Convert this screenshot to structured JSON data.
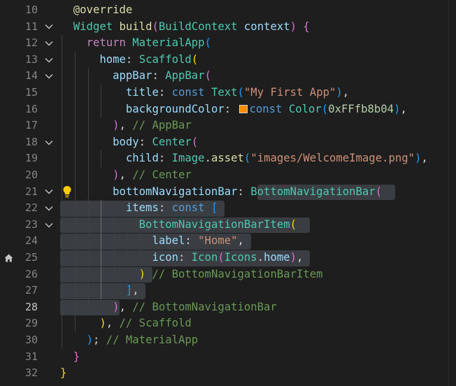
{
  "colors": {
    "background": "#1e1e1e",
    "keyword": "#569cd6",
    "control": "#c586c0",
    "type": "#4ec9b0",
    "function": "#dcdcaa",
    "variable": "#9cdcfe",
    "string": "#ce9178",
    "number": "#b5cea8",
    "comment": "#6a9955",
    "bracket_gold": "#ffd700",
    "bracket_pink": "#da70d6",
    "bracket_blue": "#179fff",
    "swatch": "#fb8b04",
    "highlight": "#3a3d41"
  },
  "editor": {
    "active_line": 28,
    "lines": [
      {
        "n": "10",
        "fold": false,
        "gutter_icon": "",
        "tokens": [
          {
            "t": "  "
          },
          {
            "t": "@override",
            "c": "#dcdcaa"
          }
        ]
      },
      {
        "n": "11",
        "fold": true,
        "gutter_icon": "",
        "tokens": [
          {
            "t": "  "
          },
          {
            "t": "Widget",
            "c": "#4ec9b0"
          },
          {
            "t": " "
          },
          {
            "t": "build",
            "c": "#dcdcaa"
          },
          {
            "t": "(",
            "c": "#da70d6"
          },
          {
            "t": "BuildContext",
            "c": "#4ec9b0"
          },
          {
            "t": " "
          },
          {
            "t": "context",
            "c": "#9cdcfe"
          },
          {
            "t": ")",
            "c": "#da70d6"
          },
          {
            "t": " "
          },
          {
            "t": "{",
            "c": "#da70d6"
          }
        ]
      },
      {
        "n": "12",
        "fold": true,
        "gutter_icon": "",
        "tokens": [
          {
            "t": "    "
          },
          {
            "t": "return",
            "c": "#c586c0"
          },
          {
            "t": " "
          },
          {
            "t": "MaterialApp",
            "c": "#4ec9b0"
          },
          {
            "t": "(",
            "c": "#179fff"
          }
        ]
      },
      {
        "n": "13",
        "fold": true,
        "gutter_icon": "",
        "tokens": [
          {
            "t": "      "
          },
          {
            "t": "home",
            "c": "#9cdcfe"
          },
          {
            "t": ": "
          },
          {
            "t": "Scaffold",
            "c": "#4ec9b0"
          },
          {
            "t": "(",
            "c": "#ffd700"
          }
        ]
      },
      {
        "n": "14",
        "fold": true,
        "gutter_icon": "",
        "tokens": [
          {
            "t": "        "
          },
          {
            "t": "appBar",
            "c": "#9cdcfe"
          },
          {
            "t": ": "
          },
          {
            "t": "AppBar",
            "c": "#4ec9b0"
          },
          {
            "t": "(",
            "c": "#da70d6"
          }
        ]
      },
      {
        "n": "15",
        "fold": false,
        "gutter_icon": "",
        "tokens": [
          {
            "t": "          "
          },
          {
            "t": "title",
            "c": "#9cdcfe"
          },
          {
            "t": ": "
          },
          {
            "t": "const",
            "c": "#569cd6"
          },
          {
            "t": " "
          },
          {
            "t": "Text",
            "c": "#4ec9b0"
          },
          {
            "t": "(",
            "c": "#179fff"
          },
          {
            "t": "\"My First App\"",
            "c": "#ce9178"
          },
          {
            "t": ")",
            "c": "#179fff"
          },
          {
            "t": ","
          }
        ]
      },
      {
        "n": "16",
        "fold": false,
        "gutter_icon": "",
        "tokens": [
          {
            "t": "          "
          },
          {
            "t": "backgroundColor",
            "c": "#9cdcfe"
          },
          {
            "t": ": "
          },
          {
            "swatch": true
          },
          {
            "t": "const",
            "c": "#569cd6"
          },
          {
            "t": " "
          },
          {
            "t": "Color",
            "c": "#4ec9b0"
          },
          {
            "t": "(",
            "c": "#179fff"
          },
          {
            "t": "0xFFfb8b04",
            "c": "#b5cea8"
          },
          {
            "t": ")",
            "c": "#179fff"
          },
          {
            "t": ","
          }
        ]
      },
      {
        "n": "17",
        "fold": false,
        "gutter_icon": "",
        "tokens": [
          {
            "t": "        "
          },
          {
            "t": ")",
            "c": "#da70d6"
          },
          {
            "t": ", "
          },
          {
            "t": "// AppBar",
            "c": "#6a9955"
          }
        ]
      },
      {
        "n": "18",
        "fold": true,
        "gutter_icon": "",
        "tokens": [
          {
            "t": "        "
          },
          {
            "t": "body",
            "c": "#9cdcfe"
          },
          {
            "t": ": "
          },
          {
            "t": "Center",
            "c": "#4ec9b0"
          },
          {
            "t": "(",
            "c": "#da70d6"
          }
        ]
      },
      {
        "n": "19",
        "fold": false,
        "gutter_icon": "",
        "tokens": [
          {
            "t": "          "
          },
          {
            "t": "child",
            "c": "#9cdcfe"
          },
          {
            "t": ": "
          },
          {
            "t": "Image",
            "c": "#4ec9b0"
          },
          {
            "t": "."
          },
          {
            "t": "asset",
            "c": "#dcdcaa"
          },
          {
            "t": "(",
            "c": "#179fff"
          },
          {
            "t": "\"images/WelcomeImage.png\"",
            "c": "#ce9178"
          },
          {
            "t": ")",
            "c": "#179fff"
          },
          {
            "t": ","
          }
        ]
      },
      {
        "n": "20",
        "fold": false,
        "gutter_icon": "",
        "tokens": [
          {
            "t": "        "
          },
          {
            "t": ")",
            "c": "#da70d6"
          },
          {
            "t": ", "
          },
          {
            "t": "// Center",
            "c": "#6a9955"
          }
        ]
      },
      {
        "n": "21",
        "fold": true,
        "gutter_icon": "",
        "bulb": true,
        "tokens": [
          {
            "t": "        "
          },
          {
            "t": "bottomNavigationBar",
            "c": "#9cdcfe"
          },
          {
            "t": ": "
          },
          {
            "t": "BottomNavigationBar",
            "c": "#4ec9b0"
          },
          {
            "t": "(",
            "c": "#da70d6"
          }
        ]
      },
      {
        "n": "22",
        "fold": true,
        "gutter_icon": "",
        "tokens": [
          {
            "t": "          "
          },
          {
            "t": "items",
            "c": "#9cdcfe"
          },
          {
            "t": ": "
          },
          {
            "t": "const",
            "c": "#569cd6"
          },
          {
            "t": " "
          },
          {
            "t": "[",
            "c": "#179fff"
          }
        ]
      },
      {
        "n": "23",
        "fold": true,
        "gutter_icon": "",
        "tokens": [
          {
            "t": "            "
          },
          {
            "t": "BottomNavigationBarItem",
            "c": "#4ec9b0"
          },
          {
            "t": "(",
            "c": "#ffd700"
          }
        ]
      },
      {
        "n": "24",
        "fold": false,
        "gutter_icon": "",
        "tokens": [
          {
            "t": "              "
          },
          {
            "t": "label",
            "c": "#9cdcfe"
          },
          {
            "t": ": "
          },
          {
            "t": "\"Home\"",
            "c": "#ce9178"
          },
          {
            "t": ","
          }
        ]
      },
      {
        "n": "25",
        "fold": false,
        "gutter_icon": "home-icon",
        "tokens": [
          {
            "t": "              "
          },
          {
            "t": "icon",
            "c": "#9cdcfe"
          },
          {
            "t": ": "
          },
          {
            "t": "Icon",
            "c": "#4ec9b0"
          },
          {
            "t": "(",
            "c": "#da70d6"
          },
          {
            "t": "Icons",
            "c": "#4ec9b0"
          },
          {
            "t": "."
          },
          {
            "t": "home",
            "c": "#9cdcfe"
          },
          {
            "t": ")",
            "c": "#da70d6"
          },
          {
            "t": ","
          }
        ]
      },
      {
        "n": "26",
        "fold": false,
        "gutter_icon": "",
        "tokens": [
          {
            "t": "            "
          },
          {
            "t": ")",
            "c": "#ffd700"
          },
          {
            "t": " "
          },
          {
            "t": "// BottomNavigationBarItem",
            "c": "#6a9955"
          }
        ]
      },
      {
        "n": "27",
        "fold": false,
        "gutter_icon": "",
        "tokens": [
          {
            "t": "          "
          },
          {
            "t": "]",
            "c": "#179fff"
          },
          {
            "t": ","
          }
        ]
      },
      {
        "n": "28",
        "fold": false,
        "gutter_icon": "",
        "tokens": [
          {
            "t": "        "
          },
          {
            "t": ")",
            "c": "#da70d6"
          },
          {
            "t": ", "
          },
          {
            "t": "// BottomNavigationBar",
            "c": "#6a9955"
          }
        ]
      },
      {
        "n": "29",
        "fold": false,
        "gutter_icon": "",
        "tokens": [
          {
            "t": "      "
          },
          {
            "t": ")",
            "c": "#ffd700"
          },
          {
            "t": ", "
          },
          {
            "t": "// Scaffold",
            "c": "#6a9955"
          }
        ]
      },
      {
        "n": "30",
        "fold": false,
        "gutter_icon": "",
        "tokens": [
          {
            "t": "    "
          },
          {
            "t": ")",
            "c": "#179fff"
          },
          {
            "t": "; "
          },
          {
            "t": "// MaterialApp",
            "c": "#6a9955"
          }
        ]
      },
      {
        "n": "31",
        "fold": false,
        "gutter_icon": "",
        "tokens": [
          {
            "t": "  "
          },
          {
            "t": "}",
            "c": "#da70d6"
          }
        ]
      },
      {
        "n": "32",
        "fold": false,
        "gutter_icon": "",
        "tokens": [
          {
            "t": "}",
            "c": "#ffd700"
          }
        ]
      }
    ]
  }
}
